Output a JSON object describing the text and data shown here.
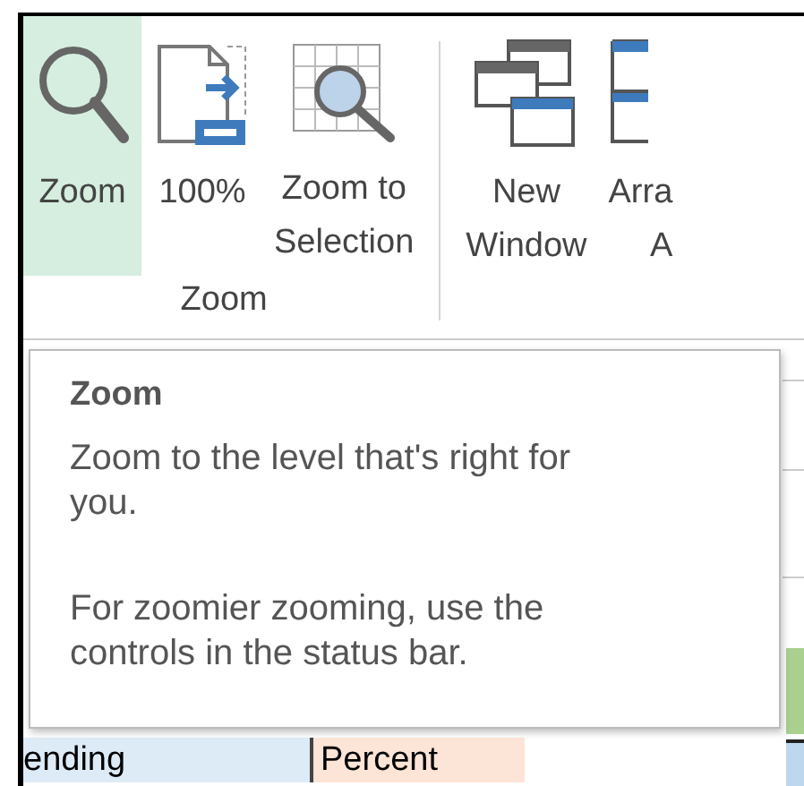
{
  "ribbon": {
    "groups": [
      {
        "label": "Zoom",
        "buttons": [
          {
            "kind": "magnifier",
            "label": "Zoom",
            "selected": true
          },
          {
            "kind": "page",
            "label": "100%",
            "selected": false
          },
          {
            "kind": "grid",
            "label": "Zoom to\nSelection",
            "selected": false
          }
        ]
      },
      {
        "buttons": [
          {
            "kind": "windows",
            "label": "New\nWindow",
            "selected": false
          },
          {
            "kind": "arrange",
            "label": "Arra\nA",
            "selected": false
          }
        ]
      }
    ]
  },
  "tooltip": {
    "title": "Zoom",
    "paragraphs": [
      "Zoom to the level that's right for you.",
      "For zoomier zooming, use the controls in the status bar."
    ]
  },
  "sheet": {
    "cells": [
      "ending",
      "Percent"
    ]
  }
}
